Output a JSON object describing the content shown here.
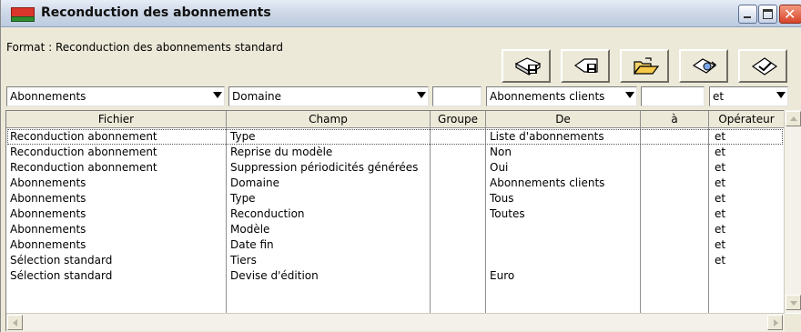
{
  "window": {
    "title": "Reconduction des abonnements"
  },
  "format": {
    "label": "Format : Reconduction des abonnements standard"
  },
  "toolbar": {
    "buttons": [
      {
        "icon": "disk-save-icon"
      },
      {
        "icon": "save-as-icon"
      },
      {
        "icon": "open-folder-icon"
      },
      {
        "icon": "refresh-disk-icon"
      },
      {
        "icon": "apply-icon"
      }
    ]
  },
  "filters": {
    "fichier": "Abonnements",
    "champ": "Domaine",
    "groupe": "",
    "de": "Abonnements clients",
    "a": "",
    "operateur": "et"
  },
  "grid": {
    "columns": [
      "Fichier",
      "Champ",
      "Groupe",
      "De",
      "à",
      "Opérateur"
    ],
    "rows": [
      {
        "fichier": "Reconduction abonnement",
        "champ": "Type",
        "groupe": "",
        "de": "Liste d'abonnements",
        "a": "",
        "op": "et"
      },
      {
        "fichier": "Reconduction abonnement",
        "champ": "Reprise du modèle",
        "groupe": "",
        "de": "Non",
        "a": "",
        "op": "et"
      },
      {
        "fichier": "Reconduction abonnement",
        "champ": "Suppression périodicités générées",
        "groupe": "",
        "de": "Oui",
        "a": "",
        "op": "et"
      },
      {
        "fichier": "Abonnements",
        "champ": "Domaine",
        "groupe": "",
        "de": "Abonnements clients",
        "a": "",
        "op": "et"
      },
      {
        "fichier": "Abonnements",
        "champ": "Type",
        "groupe": "",
        "de": "Tous",
        "a": "",
        "op": "et"
      },
      {
        "fichier": "Abonnements",
        "champ": "Reconduction",
        "groupe": "",
        "de": "Toutes",
        "a": "",
        "op": "et"
      },
      {
        "fichier": "Abonnements",
        "champ": "Modèle",
        "groupe": "",
        "de": "",
        "a": "",
        "op": "et"
      },
      {
        "fichier": "Abonnements",
        "champ": "Date fin",
        "groupe": "",
        "de": "",
        "a": "",
        "op": "et"
      },
      {
        "fichier": "Sélection standard",
        "champ": "Tiers",
        "groupe": "",
        "de": "",
        "a": "",
        "op": "et"
      },
      {
        "fichier": "Sélection standard",
        "champ": "Devise d'édition",
        "groupe": "",
        "de": "Euro",
        "a": "",
        "op": ""
      }
    ]
  },
  "colors": {
    "titlebar": "#cfd9e8",
    "window_bg": "#ece9d8",
    "close_button": "#d8452a"
  }
}
